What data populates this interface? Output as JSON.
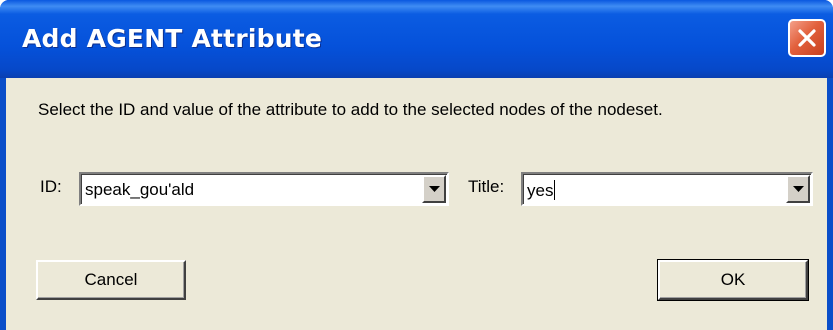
{
  "window": {
    "title": "Add AGENT Attribute",
    "close_icon": "close-icon"
  },
  "dialog": {
    "instructions": "Select the ID and value of the attribute to add to the selected nodes of the nodeset.",
    "id_field": {
      "label": "ID:",
      "value": "speak_gou'ald",
      "dropdown_icon": "chevron-down-icon"
    },
    "title_field": {
      "label": "Title:",
      "value": "yes",
      "dropdown_icon": "chevron-down-icon"
    },
    "buttons": {
      "cancel_label": "Cancel",
      "ok_label": "OK"
    }
  },
  "colors": {
    "titlebar": "#0551da",
    "close_button": "#e2603c",
    "client_background": "#ece9d8"
  }
}
